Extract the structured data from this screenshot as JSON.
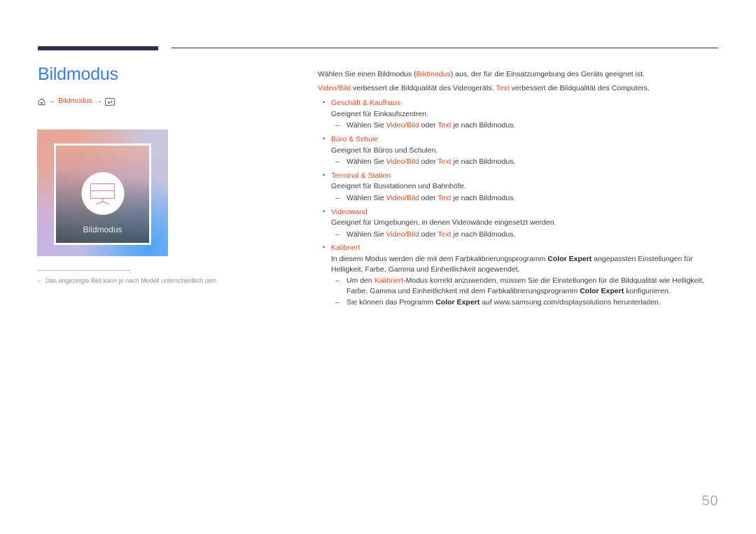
{
  "header": {
    "rule_thick_color": "#2e3155",
    "rule_thin_color": "#2e3155"
  },
  "left": {
    "title": "Bildmodus",
    "title_color": "#3a7de0",
    "breadcrumb": {
      "home_icon": "home-icon",
      "arrow1": "→",
      "item": "Bildmodus",
      "arrow2": "→",
      "enter_icon": "enter-key-icon",
      "accent_color": "#e8481f"
    },
    "illustration": {
      "label": "Bildmodus",
      "icon": "monitor-icon",
      "gradient_colors": [
        "#e8a78f",
        "#dfb0b4",
        "#c9bcdd",
        "#9fc6f2"
      ],
      "frame_color": "#ffffff"
    },
    "footnote_dash": "–",
    "footnote": "Das angezeigte Bild kann je nach Modell unterschiedlich sein."
  },
  "right": {
    "intro": {
      "line1_a": "Wählen Sie einen Bildmodus (",
      "line1_hl": "Bildmodus",
      "line1_b": ") aus, der für die Einsatzumgebung des Geräts geeignet ist.",
      "line2_hl1": "Video/Bild",
      "line2_a": " verbessert die Bildqualität des Videogeräts. ",
      "line2_hl2": "Text",
      "line2_b": " verbessert die Bildqualität des Computers."
    },
    "items": [
      {
        "title": "Geschäft & Kaufhaus",
        "desc": "Geeignet für Einkaufszentren.",
        "sub_a": "Wählen Sie ",
        "sub_hl1": "Video/Bild",
        "sub_b": " oder ",
        "sub_hl2": "Text",
        "sub_c": " je nach Bildmodus."
      },
      {
        "title": "Büro & Schule",
        "desc": "Geeignet für Büros und Schulen.",
        "sub_a": "Wählen Sie ",
        "sub_hl1": "Video/Bild",
        "sub_b": " oder ",
        "sub_hl2": "Text",
        "sub_c": " je nach Bildmodus."
      },
      {
        "title": "Terminal & Station",
        "desc": "Geeignet für Busstationen und Bahnhöfe.",
        "sub_a": "Wählen Sie ",
        "sub_hl1": "Video/Bild",
        "sub_b": " oder ",
        "sub_hl2": "Text",
        "sub_c": " je nach Bildmodus."
      },
      {
        "title": "Videowand",
        "desc": "Geeignet für Umgebungen, in denen Videowände eingesetzt werden.",
        "sub_a": "Wählen Sie ",
        "sub_hl1": "Video/Bild",
        "sub_b": " oder ",
        "sub_hl2": "Text",
        "sub_c": " je nach Bildmodus."
      }
    ],
    "kalibriert": {
      "title": "Kalibriert",
      "desc_a": "In diesem Modus werden die mit dem Farbkalibrierungsprogramm ",
      "desc_bold": "Color Expert",
      "desc_b": " angepassten Einstellungen für Helligkeit, Farbe, Gamma und Einheitlichkeit angewendet.",
      "sub1_a": "Um den ",
      "sub1_hl": "Kalibriert",
      "sub1_b": "-Modus korrekt anzuwenden, müssen Sie die Einstellungen für die Bildqualität wie Helligkeit, Farbe, Gamma und Einheitlichkeit mit dem Farbkalibrierungsprogramm ",
      "sub1_bold": "Color Expert",
      "sub1_c": " konfigurieren.",
      "sub2_a": "Sie können das Programm ",
      "sub2_bold": "Color Expert",
      "sub2_b": " auf www.samsung.com/displaysolutions herunterladen."
    }
  },
  "page_number": "50"
}
